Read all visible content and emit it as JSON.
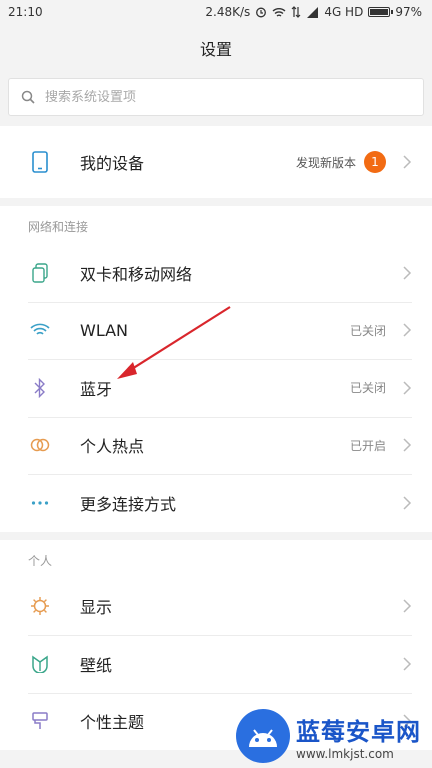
{
  "status_bar": {
    "time": "21:10",
    "speed": "2.48K/s",
    "network": "4G HD",
    "battery": "97%",
    "battery_level": 0.97
  },
  "title": "设置",
  "search": {
    "placeholder": "搜索系统设置项"
  },
  "device": {
    "label": "我的设备",
    "status": "发现新版本",
    "badge": "1",
    "icon": "phone-icon"
  },
  "sections": [
    {
      "header": "网络和连接",
      "items": [
        {
          "label": "双卡和移动网络",
          "status": "",
          "icon": "sim-icon"
        },
        {
          "label": "WLAN",
          "status": "已关闭",
          "icon": "wifi-icon"
        },
        {
          "label": "蓝牙",
          "status": "已关闭",
          "icon": "bluetooth-icon"
        },
        {
          "label": "个人热点",
          "status": "已开启",
          "icon": "hotspot-icon"
        },
        {
          "label": "更多连接方式",
          "status": "",
          "icon": "more-icon"
        }
      ]
    },
    {
      "header": "个人",
      "items": [
        {
          "label": "显示",
          "status": "",
          "icon": "display-icon"
        },
        {
          "label": "壁纸",
          "status": "",
          "icon": "wallpaper-icon"
        },
        {
          "label": "个性主题",
          "status": "",
          "icon": "theme-icon"
        }
      ]
    }
  ],
  "watermark": {
    "title": "蓝莓安卓网",
    "url": "www.lmkjst.com"
  },
  "colors": {
    "badge": "#f26b13",
    "arrow": "#d9262c",
    "watermark": "#1a55c8"
  }
}
